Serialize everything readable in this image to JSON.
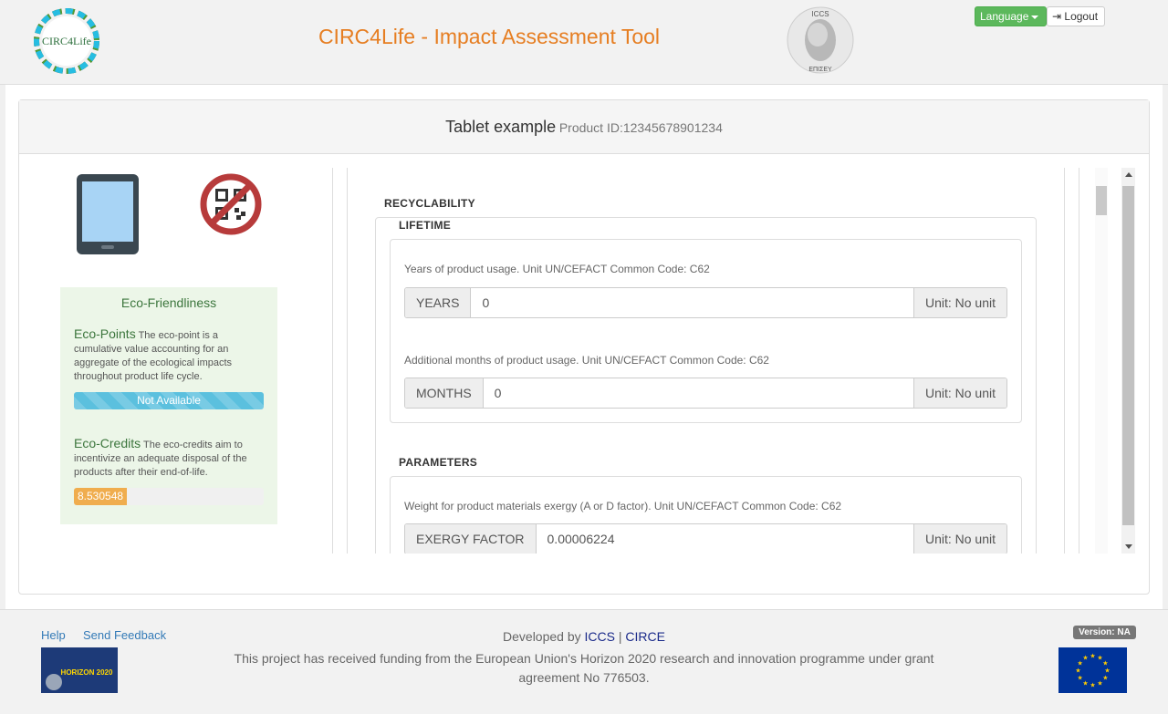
{
  "header": {
    "title": "CIRC4Life - Impact Assessment Tool",
    "left_logo_text": "CIRC4Life",
    "right_logo_top_text": "ICCS",
    "right_logo_bottom_text": "ΕΠΙΣΕΥ",
    "language_label": "Language",
    "logout_label": "Logout"
  },
  "product": {
    "name": "Tablet example",
    "id_text": "Product ID:12345678901234"
  },
  "eco": {
    "title": "Eco-Friendliness",
    "points_label": "Eco-Points",
    "points_desc": "The eco-point is a cumulative value accounting for an aggregate of the ecological impacts throughout product life cycle.",
    "points_value": "Not Available",
    "credits_label": "Eco-Credits",
    "credits_desc": "The eco-credits aim to incentivize an adequate disposal of the products after their end-of-life.",
    "credits_value": "8.530548",
    "credits_fill_fraction": 0.28
  },
  "form": {
    "section": "RECYCLABILITY",
    "lifetime_label": "LIFETIME",
    "years_desc": "Years of product usage. Unit UN/CEFACT Common Code: C62",
    "years_addon": "YEARS",
    "years_value": "0",
    "years_unit": "Unit: No unit",
    "months_desc": "Additional months of product usage. Unit UN/CEFACT Common Code: C62",
    "months_addon": "MONTHS",
    "months_value": "0",
    "months_unit": "Unit: No unit",
    "parameters_label": "PARAMETERS",
    "exergy_desc": "Weight for product materials exergy (A or D factor). Unit UN/CEFACT Common Code: C62",
    "exergy_addon": "EXERGY FACTOR",
    "exergy_value": "0.00006224",
    "exergy_unit": "Unit: No unit"
  },
  "footer": {
    "help": "Help",
    "feedback": "Send Feedback",
    "developed_by": "Developed by",
    "iccs": "ICCS",
    "separator": "|",
    "circe": "CIRCE",
    "version": "Version: NA",
    "funding": "This project has received funding from the European Union's Horizon 2020 research and innovation programme under grant agreement No 776503.",
    "horizon_text": "HORIZON 2020"
  },
  "colors": {
    "accent": "#e67e22",
    "success": "#5cb85c",
    "info": "#5bc0de",
    "warning": "#f0ad4e"
  }
}
